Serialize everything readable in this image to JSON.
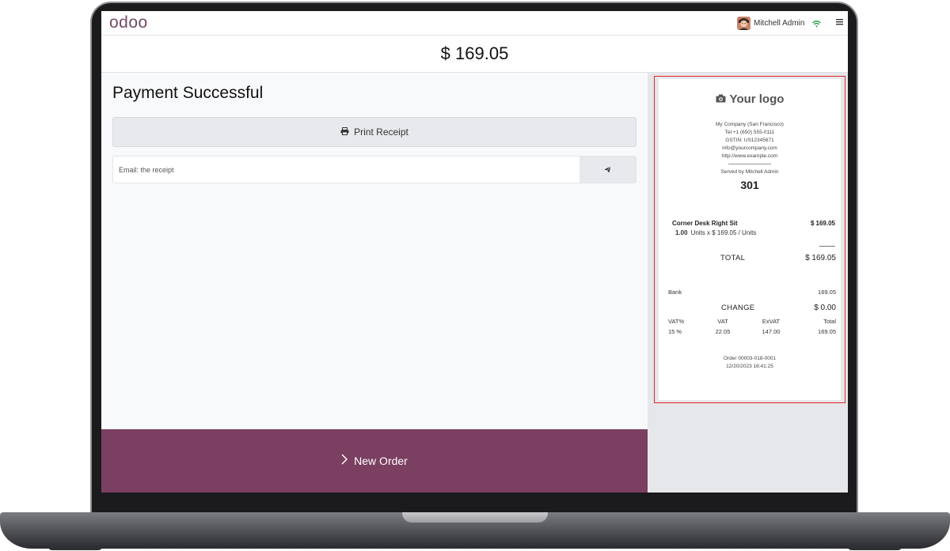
{
  "app": {
    "brand": "odoo",
    "user_name": "Mitchell Admin",
    "amount_due": "$ 169.05"
  },
  "payment": {
    "status_title": "Payment Successful",
    "print_label": "Print Receipt",
    "email_placeholder": "Email: the receipt",
    "new_order_label": "New Order"
  },
  "receipt": {
    "logo_text": "Your logo",
    "company_lines": [
      "My Company (San Francisco)",
      "Tel:+1 (650) 555-0111",
      "GSTIN: US12345671",
      "info@yourcompany.com",
      "http://www.example.com"
    ],
    "served_by": "Served by Mitchell Admin",
    "ticket_number": "301",
    "line": {
      "product": "Corner Desk Right Sit",
      "price": "$ 169.05",
      "quantity": "1.00",
      "unit_detail": "Units x $ 169.05 / Units"
    },
    "total_label": "TOTAL",
    "total_value": "$ 169.05",
    "payment_method": "Bank",
    "payment_amount": "169.05",
    "change_label": "CHANGE",
    "change_value": "$ 0.00",
    "tax_headers": [
      "VAT%",
      "VAT",
      "ExVAT",
      "Total"
    ],
    "tax_row": [
      "15 %",
      "22.05",
      "147.00",
      "169.05"
    ],
    "order_ref": "Order 00003-018-0001",
    "order_datetime": "12/20/2023 16:41:25"
  },
  "colors": {
    "brand_purple": "#714b67",
    "new_order_bg": "#7b3f61",
    "highlight_border": "#e0262d",
    "wifi_green": "#2aa14b"
  },
  "icons": [
    "print-icon",
    "send-icon",
    "chevron-right-icon",
    "camera-icon",
    "wifi-icon",
    "hamburger-menu-icon",
    "avatar"
  ]
}
